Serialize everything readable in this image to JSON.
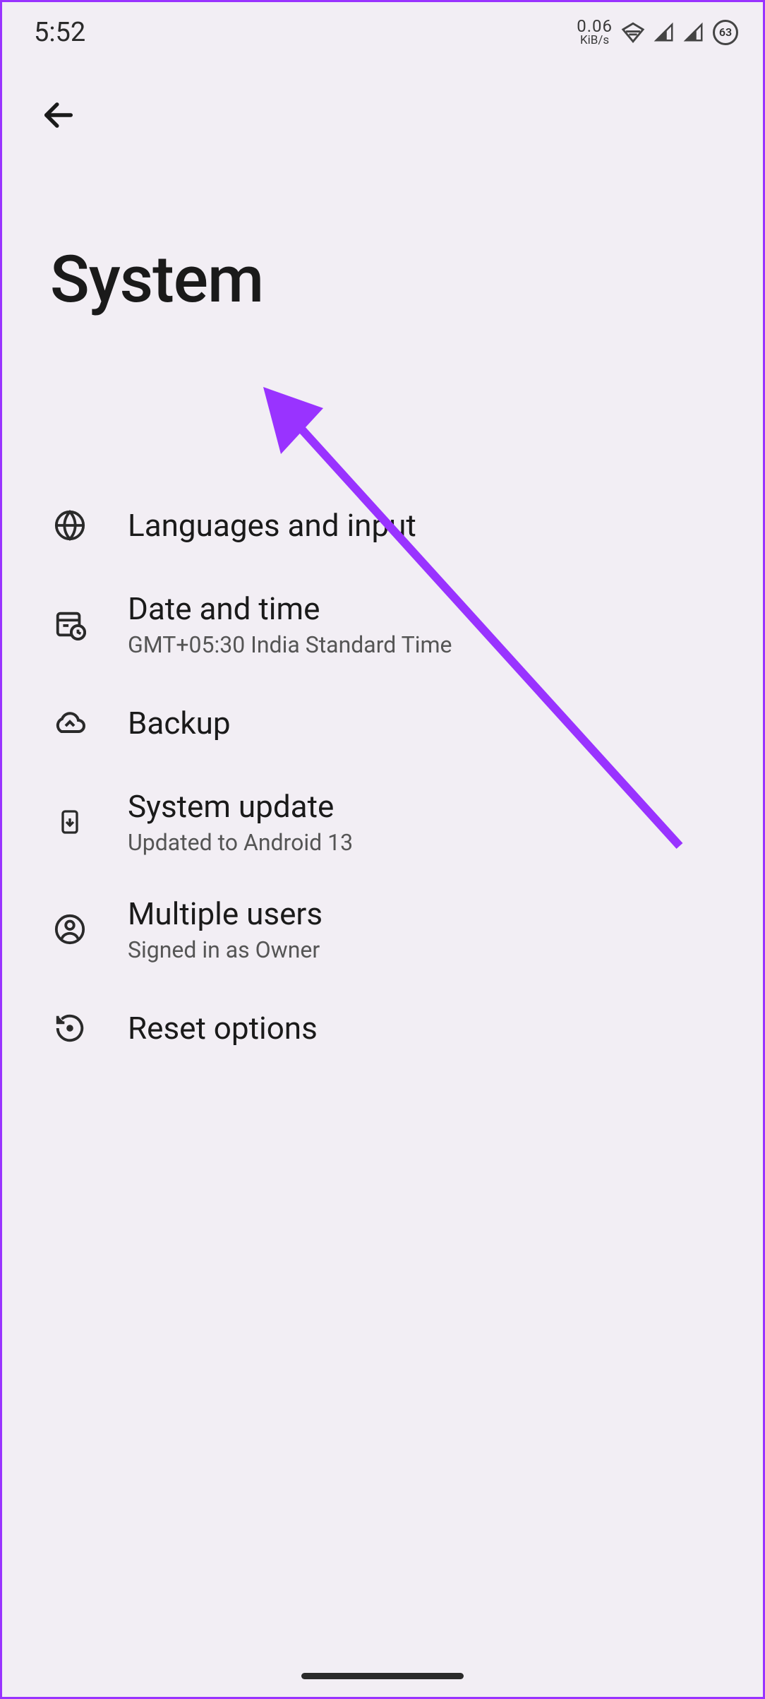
{
  "status_bar": {
    "time": "5:52",
    "data_rate_value": "0.06",
    "data_rate_unit": "KiB/s",
    "battery_level": "63"
  },
  "page": {
    "title": "System"
  },
  "menu": {
    "items": [
      {
        "title": "Languages and input",
        "subtitle": ""
      },
      {
        "title": "Date and time",
        "subtitle": "GMT+05:30 India Standard Time"
      },
      {
        "title": "Backup",
        "subtitle": ""
      },
      {
        "title": "System update",
        "subtitle": "Updated to Android 13"
      },
      {
        "title": "Multiple users",
        "subtitle": "Signed in as Owner"
      },
      {
        "title": "Reset options",
        "subtitle": ""
      }
    ]
  }
}
